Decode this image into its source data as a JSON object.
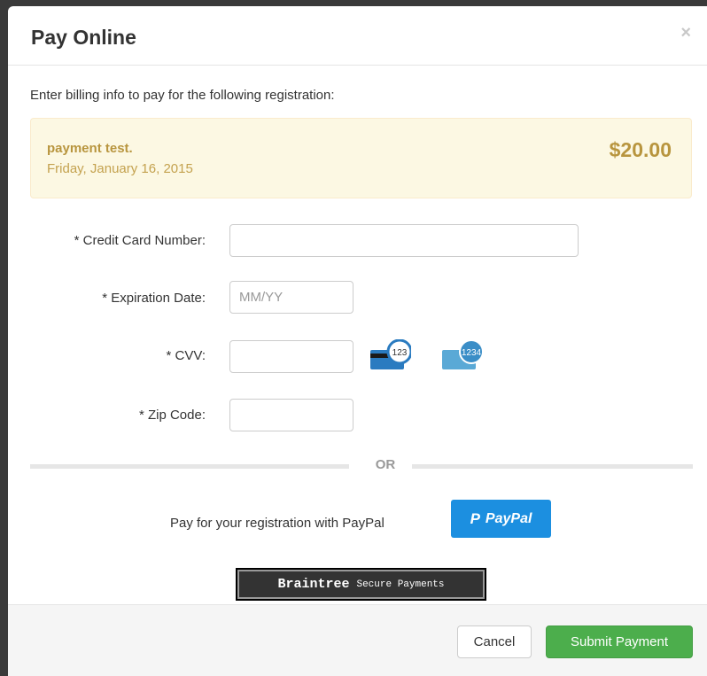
{
  "modal": {
    "title": "Pay Online",
    "close_glyph": "×",
    "intro": "Enter billing info to pay for the following registration:"
  },
  "registration": {
    "name": "payment test.",
    "date": "Friday, January 16, 2015",
    "amount": "$20.00"
  },
  "form": {
    "card_number_label": "* Credit Card Number:",
    "card_number_value": "",
    "expiration_label": "* Expiration Date:",
    "expiration_placeholder": "MM/YY",
    "cvv_label": "* CVV:",
    "cvv_value": "",
    "cvv_card_back_digits": "123",
    "cvv_card_front_digits": "1234",
    "zip_label": "* Zip Code:",
    "zip_value": ""
  },
  "separator": {
    "or_label": "OR"
  },
  "paypal": {
    "prompt": "Pay for your registration with PayPal",
    "button_label": "PayPal",
    "button_color": "#1c8fe0"
  },
  "braintree": {
    "name": "Braintree",
    "subtitle": "Secure Payments"
  },
  "footer": {
    "cancel_label": "Cancel",
    "submit_label": "Submit Payment",
    "submit_color": "#4cae4c"
  }
}
